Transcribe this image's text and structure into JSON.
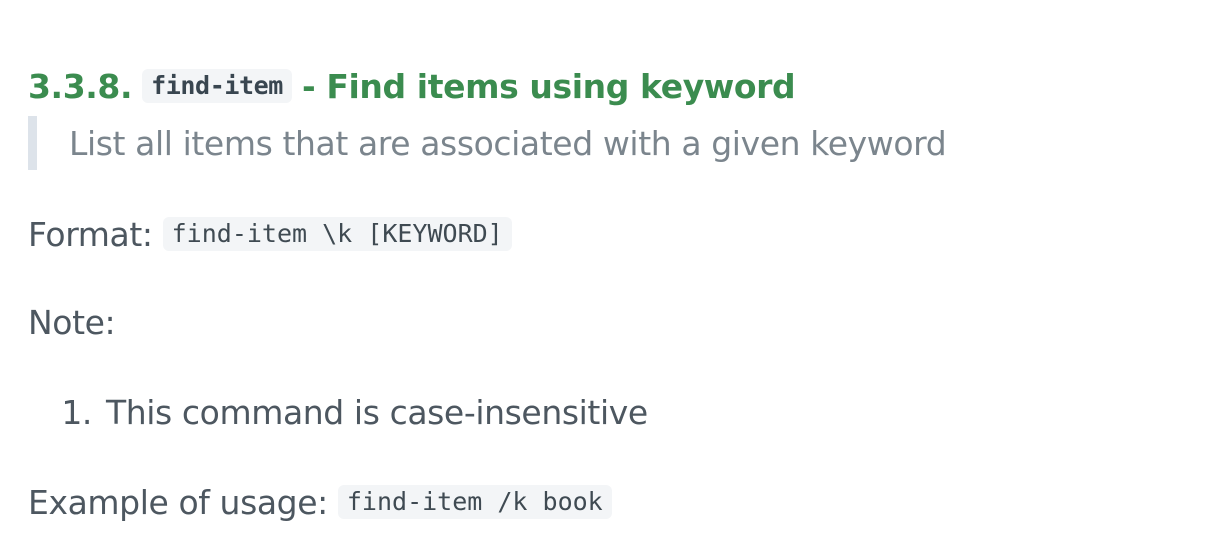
{
  "heading": {
    "number": "3.3.8.",
    "code": "find-item",
    "title": "- Find items using keyword"
  },
  "blockquote": {
    "text": "List all items that are associated with a given keyword"
  },
  "format": {
    "label": "Format:",
    "code": "find-item \\k [KEYWORD]"
  },
  "note": {
    "label": "Note:"
  },
  "notes_list": [
    {
      "marker": "1.",
      "text": "This command is case-insensitive"
    }
  ],
  "example": {
    "label": "Example of usage:",
    "code": "find-item /k book"
  },
  "colors": {
    "heading": "#3b8c4f",
    "body_text": "#4d5760",
    "quote_text": "#7b858d",
    "quote_bar": "#dde3ea",
    "code_background": "#f3f5f7"
  }
}
